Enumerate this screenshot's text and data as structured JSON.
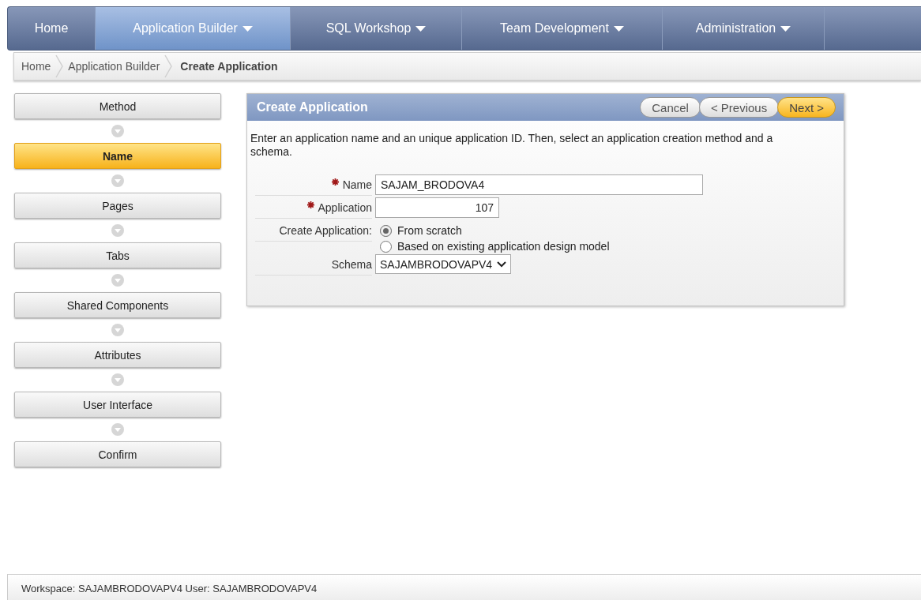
{
  "nav_tabs": [
    {
      "label": "Home",
      "selected": false,
      "dropdown": false
    },
    {
      "label": "Application Builder",
      "selected": true,
      "dropdown": true
    },
    {
      "label": "SQL Workshop",
      "selected": false,
      "dropdown": true
    },
    {
      "label": "Team Development",
      "selected": false,
      "dropdown": true
    },
    {
      "label": "Administration",
      "selected": false,
      "dropdown": true
    }
  ],
  "breadcrumb": [
    {
      "label": "Home",
      "current": false
    },
    {
      "label": "Application Builder",
      "current": false
    },
    {
      "label": "Create Application",
      "current": true
    }
  ],
  "steps": [
    {
      "label": "Method",
      "selected": false
    },
    {
      "label": "Name",
      "selected": true
    },
    {
      "label": "Pages",
      "selected": false
    },
    {
      "label": "Tabs",
      "selected": false
    },
    {
      "label": "Shared Components",
      "selected": false
    },
    {
      "label": "Attributes",
      "selected": false
    },
    {
      "label": "User Interface",
      "selected": false
    },
    {
      "label": "Confirm",
      "selected": false
    }
  ],
  "panel": {
    "title": "Create Application",
    "buttons": [
      {
        "label": "Cancel",
        "kind": "default"
      },
      {
        "label": "< Previous",
        "kind": "default"
      },
      {
        "label": "Next >",
        "kind": "primary"
      }
    ],
    "instructions": "Enter an application name and an unique application ID. Then, select an application creation method and a schema.",
    "fields": [
      {
        "kind": "text",
        "label": "Name",
        "required": true,
        "value": "SAJAM_BRODOVA4"
      },
      {
        "kind": "number",
        "label": "Application",
        "required": true,
        "value": "107"
      },
      {
        "kind": "radio",
        "label": "Create Application:",
        "required": false,
        "options": [
          {
            "label": "From scratch",
            "selected": true
          },
          {
            "label": "Based on existing application design model",
            "selected": false
          }
        ]
      },
      {
        "kind": "select",
        "label": "Schema",
        "required": false,
        "value": "SAJAMBRODOVAPV4"
      }
    ]
  },
  "status_bar": "Workspace: SAJAMBRODOVAPV4 User: SAJAMBRODOVAPV4"
}
